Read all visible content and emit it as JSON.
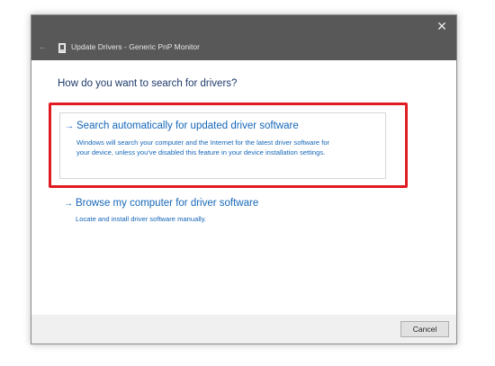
{
  "window": {
    "title": "Update Drivers - Generic PnP Monitor",
    "close_glyph": "✕",
    "back_glyph": "←",
    "icons": {
      "close": "close-icon",
      "back": "back-arrow-icon",
      "title": "monitor-icon"
    }
  },
  "main": {
    "heading": "How do you want to search for drivers?",
    "options": [
      {
        "title": "Search automatically for updated driver software",
        "description_line1": "Windows will search your computer and the Internet for the latest driver software for",
        "description_line2": "your device, unless you've disabled this feature in your device installation settings.",
        "arrow": "→",
        "highlighted": true
      },
      {
        "title": "Browse my computer for driver software",
        "description_line1": "Locate and install driver software manually.",
        "arrow": "→",
        "highlighted": false
      }
    ]
  },
  "footer": {
    "cancel_label": "Cancel"
  },
  "colors": {
    "titlebar": "#585858",
    "link": "#1566b8",
    "heading": "#1e3a6b",
    "highlight": "#e01b22",
    "footer": "#f0f0f0"
  }
}
